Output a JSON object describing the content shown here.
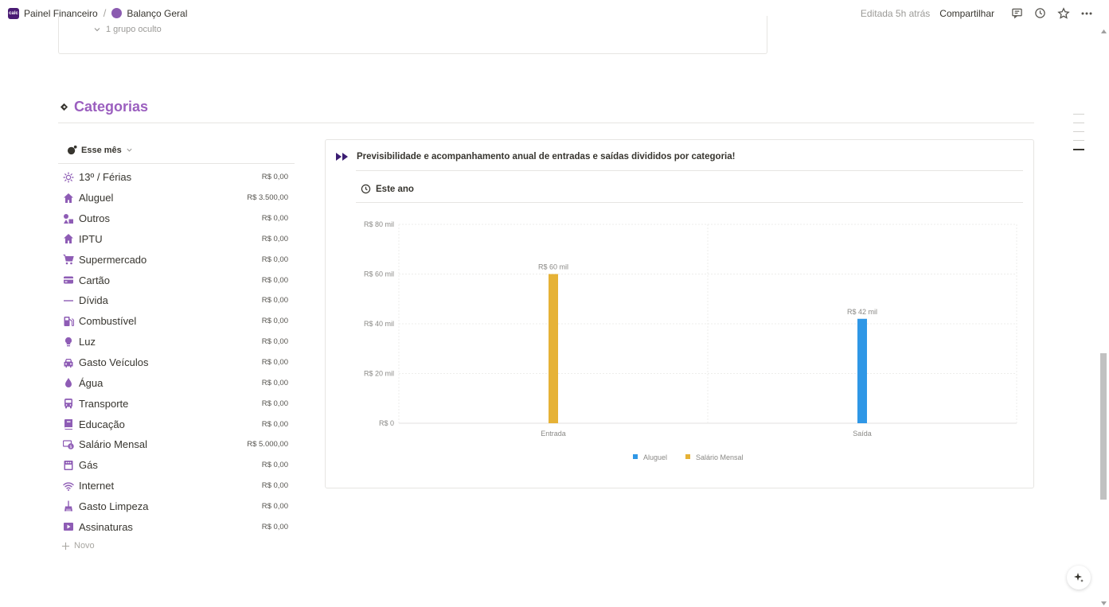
{
  "breadcrumb": {
    "workspace": "Painel Financeiro",
    "workspace_logo_text": "calc",
    "separator": "/",
    "page": "Balanço Geral"
  },
  "topbar": {
    "edited": "Editada 5h atrás",
    "share": "Compartilhar",
    "icons": [
      "comment-icon",
      "history-icon",
      "star-icon",
      "more-icon"
    ]
  },
  "upper_group": {
    "hidden_groups": "1 grupo oculto"
  },
  "section": {
    "title": "Categorias",
    "accent_color": "#9b5fbf"
  },
  "list": {
    "view_label": "Esse mês",
    "new_label": "Novo",
    "categories": [
      {
        "name": "13º / Férias",
        "value": "R$ 0,00",
        "icon": "sun-icon"
      },
      {
        "name": "Aluguel",
        "value": "R$ 3.500,00",
        "icon": "house-icon"
      },
      {
        "name": "Outros",
        "value": "R$ 0,00",
        "icon": "shapes-icon"
      },
      {
        "name": "IPTU",
        "value": "R$ 0,00",
        "icon": "house-icon"
      },
      {
        "name": "Supermercado",
        "value": "R$ 0,00",
        "icon": "cart-icon"
      },
      {
        "name": "Cartão",
        "value": "R$ 0,00",
        "icon": "credit-card-icon"
      },
      {
        "name": "Dívida",
        "value": "R$ 0,00",
        "icon": "minus-icon"
      },
      {
        "name": "Combustível",
        "value": "R$ 0,00",
        "icon": "fuel-pump-icon"
      },
      {
        "name": "Luz",
        "value": "R$ 0,00",
        "icon": "lightbulb-icon"
      },
      {
        "name": "Gasto Veículos",
        "value": "R$ 0,00",
        "icon": "car-icon"
      },
      {
        "name": "Água",
        "value": "R$ 0,00",
        "icon": "drop-icon"
      },
      {
        "name": "Transporte",
        "value": "R$ 0,00",
        "icon": "bus-icon"
      },
      {
        "name": "Educação",
        "value": "R$ 0,00",
        "icon": "book-icon"
      },
      {
        "name": "Salário Mensal",
        "value": "R$ 5.000,00",
        "icon": "money-icon"
      },
      {
        "name": "Gás",
        "value": "R$ 0,00",
        "icon": "stove-icon"
      },
      {
        "name": "Internet",
        "value": "R$ 0,00",
        "icon": "wifi-icon"
      },
      {
        "name": "Gasto Limpeza",
        "value": "R$ 0,00",
        "icon": "broom-icon"
      },
      {
        "name": "Assinaturas",
        "value": "R$ 0,00",
        "icon": "video-icon"
      }
    ]
  },
  "chart_card": {
    "title": "Previsibilidade e acompanhamento anual de entradas e saídas divididos por categoria!",
    "period": "Este ano"
  },
  "chart_data": {
    "type": "bar",
    "categories": [
      "Entrada",
      "Saída"
    ],
    "series": [
      {
        "name": "Aluguel",
        "values": [
          0,
          42000
        ],
        "color": "#2f97e6"
      },
      {
        "name": "Salário Mensal",
        "values": [
          60000,
          0
        ],
        "color": "#e6b236"
      }
    ],
    "data_labels": [
      "R$ 60 mil",
      "R$ 42 mil"
    ],
    "ylim": [
      0,
      80000
    ],
    "yticks": [
      0,
      20000,
      40000,
      60000,
      80000
    ],
    "ytick_labels": [
      "R$ 0",
      "R$ 20 mil",
      "R$ 40 mil",
      "R$ 60 mil",
      "R$ 80 mil"
    ],
    "grid": true,
    "legend": "bottom-center"
  }
}
